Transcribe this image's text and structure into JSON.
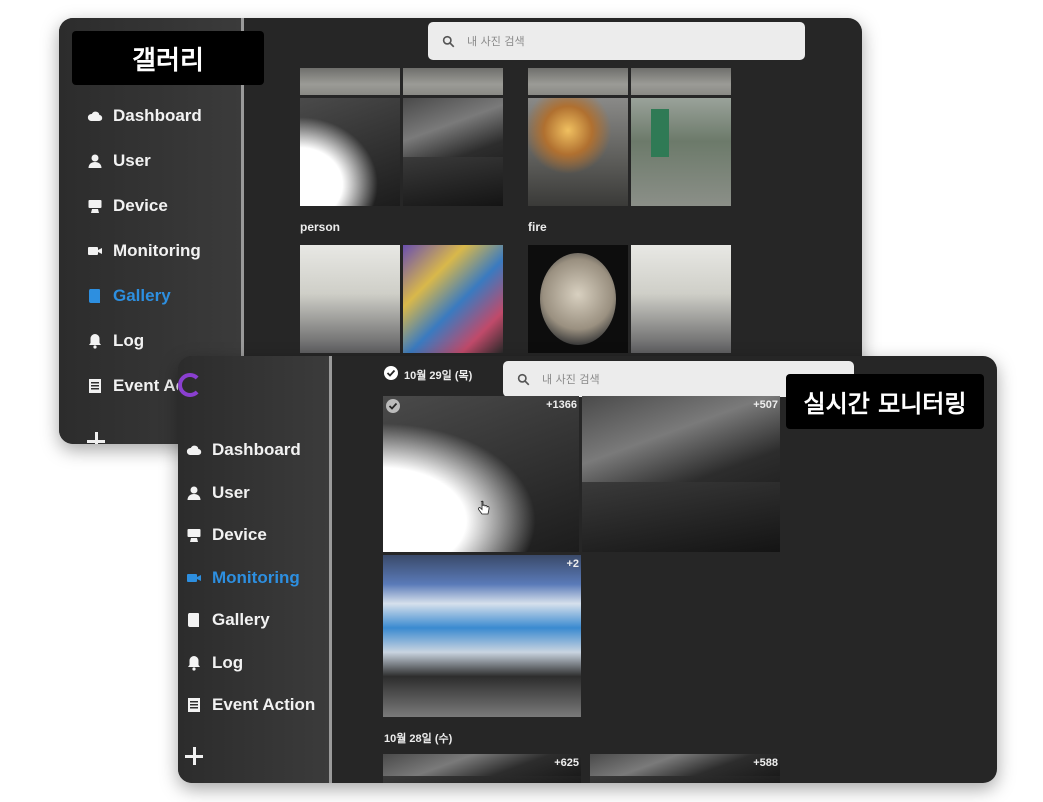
{
  "gallery_window": {
    "title_label": "갤러리",
    "search": {
      "placeholder": "내 사진 검색"
    },
    "sidebar": {
      "items": [
        {
          "label": "Dashboard",
          "icon": "cloud-icon",
          "active": false
        },
        {
          "label": "User",
          "icon": "user-icon",
          "active": false
        },
        {
          "label": "Device",
          "icon": "device-icon",
          "active": false
        },
        {
          "label": "Monitoring",
          "icon": "camera-icon",
          "active": false
        },
        {
          "label": "Gallery",
          "icon": "book-icon",
          "active": true
        },
        {
          "label": "Log",
          "icon": "bell-icon",
          "active": false
        },
        {
          "label": "Event Ac",
          "icon": "list-icon",
          "active": false
        }
      ]
    },
    "groups": [
      {
        "caption": "person"
      },
      {
        "caption": "fire"
      }
    ]
  },
  "monitoring_window": {
    "title_label": "실시간 모니터링",
    "search": {
      "placeholder": "내 사진 검색"
    },
    "sidebar": {
      "items": [
        {
          "label": "Dashboard",
          "icon": "cloud-icon",
          "active": false
        },
        {
          "label": "User",
          "icon": "user-icon",
          "active": false
        },
        {
          "label": "Device",
          "icon": "device-icon",
          "active": false
        },
        {
          "label": "Monitoring",
          "icon": "camera-icon",
          "active": true
        },
        {
          "label": "Gallery",
          "icon": "book-icon",
          "active": false
        },
        {
          "label": "Log",
          "icon": "bell-icon",
          "active": false
        },
        {
          "label": "Event Action",
          "icon": "list-icon",
          "active": false
        }
      ]
    },
    "sections": [
      {
        "date": "10월 29일 (목)",
        "counts": [
          "+1366",
          "+507",
          "+2"
        ]
      },
      {
        "date": "10월 28일 (수)",
        "counts": [
          "+625",
          "+588"
        ]
      }
    ]
  },
  "colors": {
    "accent": "#2d8fe0",
    "panel": "#262626",
    "sidebar": "#333333",
    "search_bg": "#ececec"
  }
}
